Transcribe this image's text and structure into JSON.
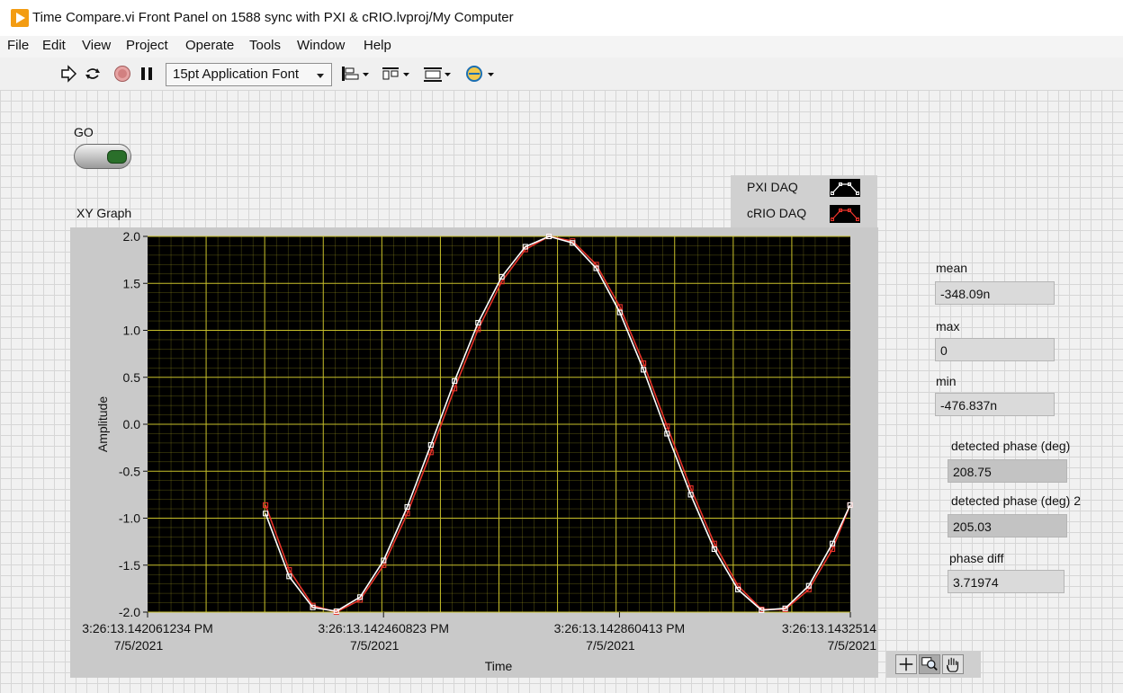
{
  "window": {
    "title": "Time Compare.vi Front Panel on 1588 sync with PXI & cRIO.lvproj/My Computer"
  },
  "menu": [
    "File",
    "Edit",
    "View",
    "Project",
    "Operate",
    "Tools",
    "Window",
    "Help"
  ],
  "toolbar": {
    "font_label": "15pt Application Font",
    "icons": [
      "run-arrow-icon",
      "run-continuous-icon",
      "abort-icon",
      "pause-icon",
      "align-objects-icon",
      "distribute-objects-icon",
      "resize-objects-icon",
      "reorder-icon"
    ]
  },
  "go": {
    "label": "GO"
  },
  "graph": {
    "label": "XY Graph"
  },
  "legend": [
    {
      "name": "PXI DAQ",
      "color": "#ffffff"
    },
    {
      "name": "cRIO DAQ",
      "color": "#e8332a"
    }
  ],
  "indicators": {
    "mean": {
      "label": "mean",
      "value": "-348.09n"
    },
    "max": {
      "label": "max",
      "value": "0"
    },
    "min": {
      "label": "min",
      "value": "-476.837n"
    },
    "phase1": {
      "label": "detected phase (deg)",
      "value": "208.75"
    },
    "phase2": {
      "label": "detected phase (deg) 2",
      "value": "205.03"
    },
    "phase_diff": {
      "label": "phase diff",
      "value": "3.71974"
    }
  },
  "graph_palette": [
    "cursor-crosshair-icon",
    "zoom-icon",
    "pan-hand-icon"
  ],
  "chart_data": {
    "type": "scatter",
    "title": "",
    "xlabel": "Time",
    "ylabel": "Amplitude",
    "ylim": [
      -2.0,
      2.0
    ],
    "xlim": [
      "3:26:13.142061234 PM",
      "3:26:13.1432514"
    ],
    "x_tick_labels": [
      [
        "3:26:13.142061234 PM",
        "7/5/2021"
      ],
      [
        "3:26:13.142460823 PM",
        "7/5/2021"
      ],
      [
        "3:26:13.142860413 PM",
        "7/5/2021"
      ],
      [
        "3:26:13.1432514",
        "7/5/2021"
      ]
    ],
    "y_tick_labels": [
      "2.0",
      "1.5",
      "1.0",
      "0.5",
      "0.0",
      "-0.5",
      "-1.0",
      "-1.5",
      "-2.0"
    ],
    "y_ticks": [
      2.0,
      1.5,
      1.0,
      0.5,
      0.0,
      -0.5,
      -1.0,
      -1.5,
      -2.0
    ],
    "x_ticks": [
      "3:26:13.142061234 PM",
      "3:26:13.142460823 PM",
      "3:26:13.142860413 PM",
      "3:26:13.1432514"
    ],
    "grid": true,
    "legend_position": "top-right",
    "plot_background": "#000000",
    "grid_color": "#c8c02a",
    "series": [
      {
        "name": "PXI DAQ",
        "color": "#ffffff",
        "x": [
          "3:26:13.142261",
          "3:26:13.142301",
          "3:26:13.142341",
          "3:26:13.142381",
          "3:26:13.142421",
          "3:26:13.142461",
          "3:26:13.142501",
          "3:26:13.142541",
          "3:26:13.142581",
          "3:26:13.142621",
          "3:26:13.142661",
          "3:26:13.142701",
          "3:26:13.142741",
          "3:26:13.142781",
          "3:26:13.142821",
          "3:26:13.142861",
          "3:26:13.142901",
          "3:26:13.142941",
          "3:26:13.142981",
          "3:26:13.143021",
          "3:26:13.143061",
          "3:26:13.143101",
          "3:26:13.143141",
          "3:26:13.143181",
          "3:26:13.143221",
          "3:26:13.143251"
        ],
        "values": [
          -0.95,
          -1.62,
          -1.95,
          -1.99,
          -1.84,
          -1.45,
          -0.88,
          -0.22,
          0.46,
          1.08,
          1.57,
          1.89,
          2.0,
          1.93,
          1.66,
          1.19,
          0.58,
          -0.1,
          -0.75,
          -1.33,
          -1.76,
          -1.98,
          -1.96,
          -1.72,
          -1.27,
          -0.86
        ]
      },
      {
        "name": "cRIO DAQ",
        "color": "#e8332a",
        "x": [
          "3:26:13.142261",
          "3:26:13.142301",
          "3:26:13.142341",
          "3:26:13.142381",
          "3:26:13.142421",
          "3:26:13.142461",
          "3:26:13.142501",
          "3:26:13.142541",
          "3:26:13.142581",
          "3:26:13.142621",
          "3:26:13.142661",
          "3:26:13.142701",
          "3:26:13.142741",
          "3:26:13.142781",
          "3:26:13.142821",
          "3:26:13.142861",
          "3:26:13.142901",
          "3:26:13.142941",
          "3:26:13.142981",
          "3:26:13.143021",
          "3:26:13.143061",
          "3:26:13.143101",
          "3:26:13.143141",
          "3:26:13.143181",
          "3:26:13.143221",
          "3:26:13.143251"
        ],
        "values": [
          -0.86,
          -1.55,
          -1.93,
          -2.0,
          -1.87,
          -1.5,
          -0.95,
          -0.3,
          0.38,
          1.01,
          1.52,
          1.86,
          2.0,
          1.95,
          1.7,
          1.25,
          0.65,
          -0.02,
          -0.68,
          -1.27,
          -1.72,
          -1.97,
          -1.97,
          -1.76,
          -1.33,
          -0.86
        ]
      }
    ]
  }
}
